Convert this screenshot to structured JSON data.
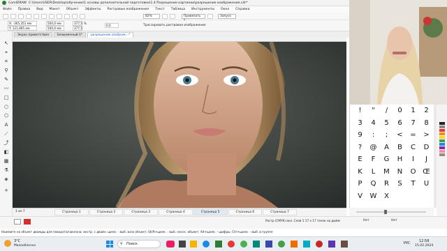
{
  "window": {
    "app": "CorelDRAW",
    "path": "C:\\Users\\USER\\Desktop\\обучение\\1 основы дополнительной подготовки\\1.4 Разрешение картинки\\разрешение изображения.cdr*"
  },
  "menu": [
    "Файл",
    "Правка",
    "Вид",
    "Макет",
    "Объект",
    "Эффекты",
    "Растровые изображения",
    "Текст",
    "Таблица",
    "Инструменты",
    "Окно",
    "Справка"
  ],
  "toolbar": {
    "zoom": "82%",
    "snap": "Привязать к",
    "launch": "Запуск"
  },
  "props": {
    "x": "X: -365,351 мм",
    "y": "Y: 121,865 мм",
    "w": "500,0 мм",
    "h": "500,0 мм",
    "sx": "377,5",
    "sy": "377,5",
    "pct": "%",
    "angle": "0,0",
    "trace": "Трассировать растровое изображение"
  },
  "doctabs": [
    "Экран приветствия",
    "Безымянный-1*",
    "разрешение изображ...*"
  ],
  "pages": {
    "nav": "1 из 7",
    "items": [
      "Страница 1",
      "Страница 2",
      "Страница 3",
      "Страница 4",
      "Страница 5",
      "Страница 6",
      "Страница 7"
    ],
    "active": 4
  },
  "status": {
    "text": "Нажмите на объект дважды для поворота/наклона; инстр. с двойн. щелк. - выб. всех объект; Shift+щелк. - выб. несск. объект; Alt+щелк. - щифры; Ctrl+щелк. - выб. в группе",
    "color": "Растр (CMYK) вкл. Слой 1 17 x 17 точек на дюйм",
    "fill": "Нет",
    "outline": "Нет"
  },
  "glyphs": [
    "!",
    "\"",
    "/",
    "0",
    "1",
    "2",
    "3",
    "4",
    "5",
    "6",
    "7",
    "8",
    "9",
    ":",
    ";",
    "<",
    "=",
    ">",
    "?",
    "@",
    "A",
    "B",
    "C",
    "D",
    "E",
    "F",
    "G",
    "H",
    "I",
    "J",
    "K",
    "L",
    "M",
    "N",
    "O",
    "Œ",
    "P",
    "Q",
    "R",
    "S",
    "T",
    "U",
    "V",
    "W",
    "X"
  ],
  "taskbar": {
    "weather_temp": "3°C",
    "weather_desc": "Малооблачно",
    "search": "Поиск",
    "lang": "РУС",
    "time": "12:58",
    "date": "15.02.2024"
  },
  "colors": {
    "accent": "#1565c0",
    "red": "#d32f2f",
    "canvas_bg": "#3a3f3c"
  }
}
